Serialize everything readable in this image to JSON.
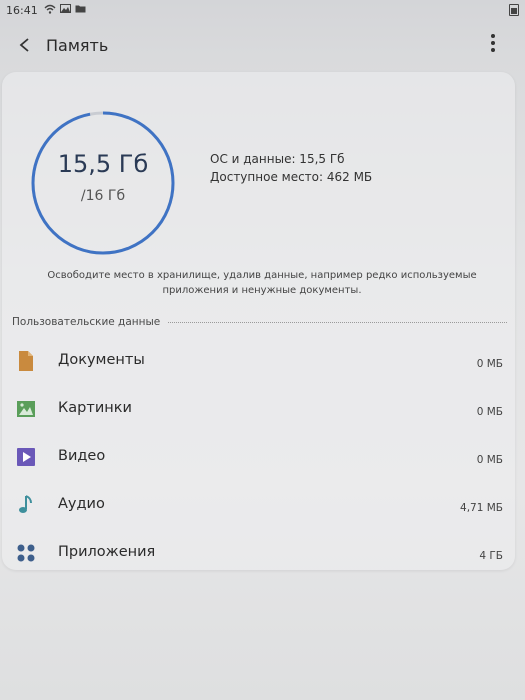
{
  "status_bar": {
    "time": "16:41"
  },
  "app_bar": {
    "title": "Память"
  },
  "storage": {
    "used": "15,5 Гб",
    "total": "/16 Гб",
    "used_fraction": 0.97,
    "os_data": "ОС и данные: 15,5 Гб",
    "available": "Доступное место: 462 МБ",
    "ring_color": "#3f73c4"
  },
  "hint": {
    "line1": "Освободите место в хранилище, удалив данные, например редко используемые",
    "line2": "приложения и ненужные документы."
  },
  "section": {
    "title": "Пользовательские данные"
  },
  "items": [
    {
      "name": "Документы",
      "size": "0 МБ",
      "icon": "document-icon",
      "color": "#c98a3e"
    },
    {
      "name": "Картинки",
      "size": "0 МБ",
      "icon": "image-icon",
      "color": "#5a9e5a"
    },
    {
      "name": "Видео",
      "size": "0 МБ",
      "icon": "video-icon",
      "color": "#6a58b8"
    },
    {
      "name": "Аудио",
      "size": "4,71 МБ",
      "icon": "music-note-icon",
      "color": "#3e8f9c"
    },
    {
      "name": "Приложения",
      "size": "4 ГБ",
      "icon": "apps-grid-icon",
      "color": "#3e5f8c"
    }
  ]
}
